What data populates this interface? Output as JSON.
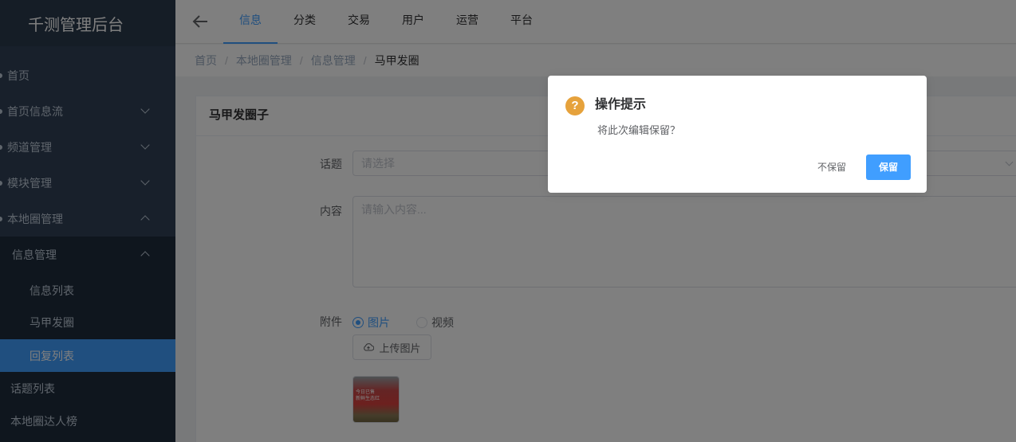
{
  "app": {
    "title": "千测管理后台"
  },
  "sidebar": {
    "items": [
      {
        "label": "首页"
      },
      {
        "label": "首页信息流"
      },
      {
        "label": "频道管理"
      },
      {
        "label": "模块管理"
      },
      {
        "label": "本地圈管理"
      },
      {
        "label": "信息管理"
      },
      {
        "label": "信息列表"
      },
      {
        "label": "马甲发圈"
      },
      {
        "label": "回复列表"
      },
      {
        "label": "话题列表"
      },
      {
        "label": "本地圈达人榜"
      }
    ]
  },
  "topnav": {
    "back_icon": "arrow-left-icon",
    "tabs": [
      {
        "label": "信息"
      },
      {
        "label": "分类"
      },
      {
        "label": "交易"
      },
      {
        "label": "用户"
      },
      {
        "label": "运营"
      },
      {
        "label": "平台"
      }
    ]
  },
  "breadcrumb": [
    "首页",
    "本地圈管理",
    "信息管理",
    "马甲发圈"
  ],
  "form": {
    "card_title": "马甲发圈子",
    "topic_label": "话题",
    "topic_placeholder": "请选择",
    "content_label": "内容",
    "content_placeholder": "请输入内容...",
    "attachment_label": "附件",
    "radio_image": "图片",
    "radio_video": "视频",
    "upload_label": "上传图片",
    "thumb_text_1": "今日已售",
    "thumb_text_2": "新鲜生态红"
  },
  "dialog": {
    "title": "操作提示",
    "message": "将此次编辑保留？",
    "cancel_label": "不保留",
    "confirm_label": "保留",
    "icon": "question-icon",
    "icon_glyph": "?"
  },
  "colors": {
    "accent": "#409eff",
    "sidebar_bg": "#304156",
    "warning": "#e6a23c"
  }
}
